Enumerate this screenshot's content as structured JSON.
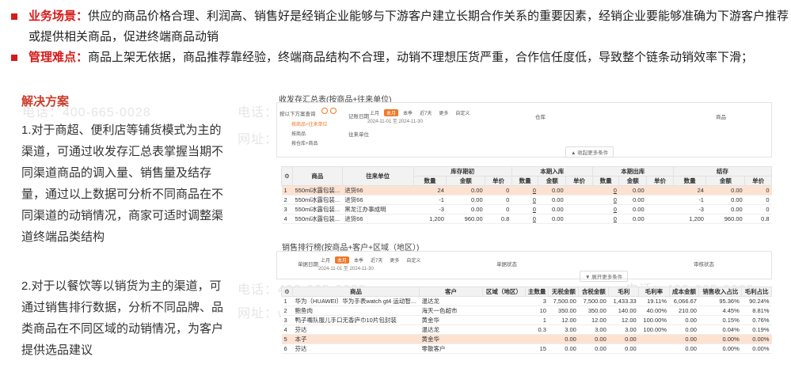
{
  "bullets": [
    {
      "label": "业务场景：",
      "text": "供应的商品价格合理、利润高、销售好是经销企业能够与下游客户建立长期合作关系的重要因素，经销企业要能够准确为下游客户推荐或提供相关商品，促进终端商品动销"
    },
    {
      "label": "管理难点：",
      "text": "商品上架无依据，商品推荐靠经验，终端商品结构不合理，动销不理想压货严重，合作信任度低，导致整个链条动销效率下滑；"
    }
  ],
  "solution": {
    "title": "解决方案",
    "para1": "1.对于商超、便利店等铺货模式为主的渠道，可通过收发存汇总表掌握当期不同渠道商品的调入量、销售量及结存量，通过以上数据可分析不同商品在不同渠道的动销情况，商家可适时调整渠道终端品类结构",
    "para2": "2.对于以餐饮等以销货为主的渠道，可通过销售排行数据，分析不同品牌、品类商品在不同区域的动销情况，为客户提供选品建议"
  },
  "watermark": {
    "phone": "电话：400-665-0028",
    "site": "网址：www.chanjet.net"
  },
  "report1": {
    "title": "收发存汇总表(按商品+往来单位)",
    "tree_header": "按以下方案查询",
    "tree_items": [
      "按商品+往来单位",
      "按商品",
      "按仓库+商品"
    ],
    "date_label": "记账日期",
    "chips": [
      "上月",
      "本月",
      "本季",
      "近7天",
      "更多",
      "自定义"
    ],
    "date_range": "2024-11-01 至 2024-11-30",
    "warehouse_label": "仓库",
    "goods_label": "商品",
    "customer_label": "往来单位",
    "more_btn": "▲ 收起更多条件",
    "cols_top": [
      "商品",
      "往来单位",
      "库存期初",
      "本期入库",
      "本期出库",
      "结存"
    ],
    "cols_sub": [
      "数量",
      "金额",
      "单价",
      "数量",
      "金额",
      "单价",
      "数量",
      "金额",
      "单价",
      "数量",
      "金额",
      "单价"
    ],
    "rows": [
      {
        "no": "1",
        "goods": "550ml冰露包装...",
        "partner": "进货66",
        "v": [
          "24",
          "0.00",
          "0",
          "0",
          "0.00",
          "",
          "0",
          "0.00",
          "",
          "24",
          "0.00",
          "0"
        ]
      },
      {
        "no": "2",
        "goods": "550ml冰露包装...",
        "partner": "进货66",
        "v": [
          "-1",
          "0.00",
          "0",
          "0",
          "0.00",
          "",
          "0",
          "0.00",
          "",
          "-1",
          "0.00",
          "0"
        ]
      },
      {
        "no": "3",
        "goods": "550ml冰露包装...",
        "partner": "黑龙江办事成明",
        "v": [
          "-3",
          "0.00",
          "0",
          "0",
          "0.00",
          "",
          "0",
          "0.00",
          "",
          "-3",
          "0.00",
          "0"
        ]
      },
      {
        "no": "4",
        "goods": "550ml冰露包装...",
        "partner": "进货66",
        "v": [
          "1,200",
          "960.00",
          "0.8",
          "0",
          "0.00",
          "",
          "0",
          "0.00",
          "",
          "1,200",
          "960.00",
          "0.8"
        ]
      }
    ]
  },
  "report2": {
    "title": "销售排行榜(按商品+客户+区域（地区）)",
    "date_label": "单据日期",
    "chips": [
      "上月",
      "本月",
      "本季",
      "近7天",
      "更多",
      "自定义"
    ],
    "date_range": "2024-11-01 至 2024-11-30",
    "status_label": "单据状态",
    "review_label": "审核状态",
    "more_btn": "▼ 展开更多条件",
    "cols": [
      "商品",
      "客户",
      "区域（地区）",
      "主数量",
      "无税金额",
      "含税金额",
      "毛利",
      "毛利率",
      "成本金额",
      "销售收入占比",
      "毛利占比"
    ],
    "rows": [
      {
        "no": "1",
        "v": [
          "华为（HUAWEI）华为手表watch gt4 运动智...",
          "温达龙",
          "",
          "3",
          "7,500.00",
          "7,500.00",
          "1,433.33",
          "19.11%",
          "6,066.67",
          "95.36%",
          "90.24%"
        ]
      },
      {
        "no": "2",
        "v": [
          "鲍鱼肉",
          "海天一色超市",
          "",
          "10",
          "350.00",
          "350.00",
          "140.00",
          "40.00%",
          "210.00",
          "4.45%",
          "8.81%"
        ]
      },
      {
        "no": "3",
        "v": [
          "鸭子嘴队服儿手口无香庐巾10片包封装",
          "黄金华",
          "",
          "1",
          "12.00",
          "12.00",
          "12.00",
          "100.00%",
          "0.00",
          "0.15%",
          "0.76%"
        ]
      },
      {
        "no": "4",
        "v": [
          "芬达",
          "温达龙",
          "",
          "0.3",
          "3.00",
          "3.00",
          "3.00",
          "100.00%",
          "0.00",
          "0.04%",
          "0.19%"
        ]
      },
      {
        "no": "5",
        "v": [
          "本子",
          "黄金华",
          "",
          "",
          "0.00",
          "0.00",
          "0.00",
          "",
          "0.00",
          "0.00%",
          "0.00%"
        ]
      },
      {
        "no": "6",
        "v": [
          "芬达",
          "零散客户",
          "",
          "15",
          "0.00",
          "0.00",
          "0.00",
          "",
          "0.00",
          "0.00%",
          "0.00%"
        ]
      }
    ]
  },
  "colors": {
    "accent": "#d51b1b",
    "highlight": "#fde2d2",
    "chip": "#f07828"
  }
}
